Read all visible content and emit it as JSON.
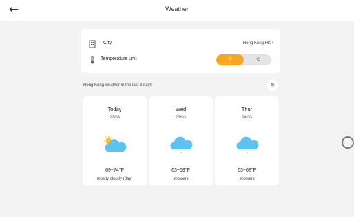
{
  "header": {
    "title": "Weather",
    "back_icon": "back-arrow-icon"
  },
  "settings": {
    "city_label": "City",
    "city_value": "Hong Kong,HK",
    "city_icon": "building-icon",
    "unit_label": "Temperature unit",
    "unit_icon": "thermometer-icon",
    "unit_options": [
      "°F",
      "°C"
    ],
    "unit_selected": "°F"
  },
  "forecast": {
    "section_title": "Hong Kong weather in the last 3 days",
    "refresh_icon": "refresh-icon",
    "days": [
      {
        "day": "Today",
        "date": "22/03",
        "temp": "69~74°F",
        "desc": "mostly cloudy (day)",
        "icon": "partly-cloudy-icon"
      },
      {
        "day": "Wed",
        "date": "23/03",
        "temp": "63~69°F",
        "desc": "showers",
        "icon": "showers-icon"
      },
      {
        "day": "Thur",
        "date": "24/03",
        "temp": "63~68°F",
        "desc": "showers",
        "icon": "showers-icon"
      }
    ]
  },
  "colors": {
    "accent": "#f5a623",
    "cloud": "#5ec2f0",
    "sun": "#f7c31c"
  }
}
